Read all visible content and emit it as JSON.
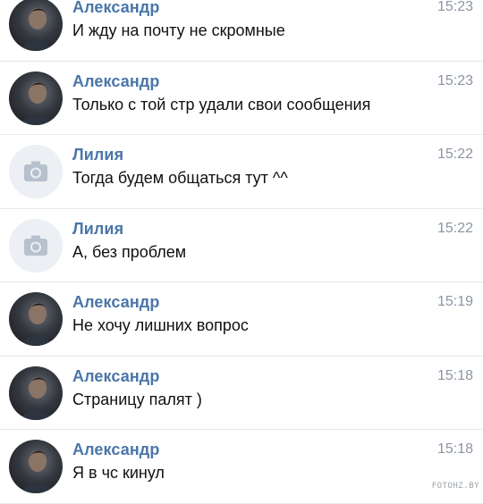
{
  "messages": [
    {
      "sender": "Александр",
      "time": "15:23",
      "text": "И жду на почту не скромные",
      "avatar": "photo"
    },
    {
      "sender": "Александр",
      "time": "15:23",
      "text": "Только с той стр удали свои сообщения",
      "avatar": "photo"
    },
    {
      "sender": "Лилия",
      "time": "15:22",
      "text": "Тогда будем общаться тут ^^",
      "avatar": "camera-placeholder"
    },
    {
      "sender": "Лилия",
      "time": "15:22",
      "text": "А, без проблем",
      "avatar": "camera-placeholder"
    },
    {
      "sender": "Александр",
      "time": "15:19",
      "text": "Не хочу лишних вопрос",
      "avatar": "photo"
    },
    {
      "sender": "Александр",
      "time": "15:18",
      "text": "Страницу палят )",
      "avatar": "photo"
    },
    {
      "sender": "Александр",
      "time": "15:18",
      "text": "Я в чс кинул",
      "avatar": "photo"
    }
  ],
  "colors": {
    "sender_name": "#4a76a8",
    "time": "#8b95a2",
    "text": "#111111",
    "divider": "#e7e8ec"
  },
  "watermark": "FOTOHZ.BY"
}
